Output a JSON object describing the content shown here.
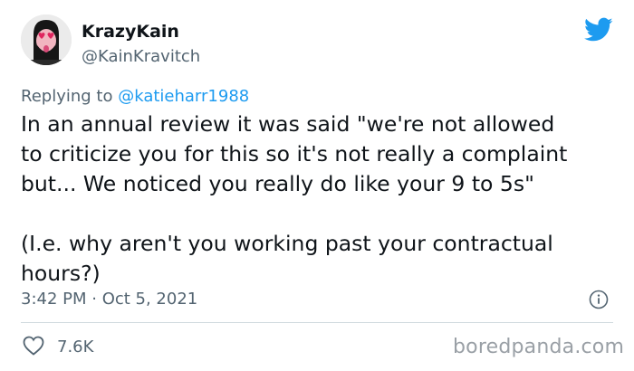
{
  "user": {
    "display_name": "KrazyKain",
    "handle": "@KainKravitch"
  },
  "reply": {
    "prefix": "Replying to",
    "mention": "@katieharr1988"
  },
  "tweet": {
    "lines": [
      "In an annual review it was said \"we're not allowed",
      "to criticize you for this so it's not really a complaint",
      "but... We noticed you really do like your 9 to 5s\"",
      "",
      "(I.e. why aren't you working past your contractual",
      "hours?)"
    ],
    "timestamp": "3:42 PM · Oct 5, 2021",
    "likes": "7.6K"
  },
  "watermark": "boredpanda.com",
  "icons": {
    "brand": "twitter-bird-icon",
    "info": "info-icon",
    "like": "heart-icon"
  },
  "colors": {
    "twitter_blue": "#1d9bf0",
    "text": "#0f1419",
    "secondary": "#536471"
  }
}
